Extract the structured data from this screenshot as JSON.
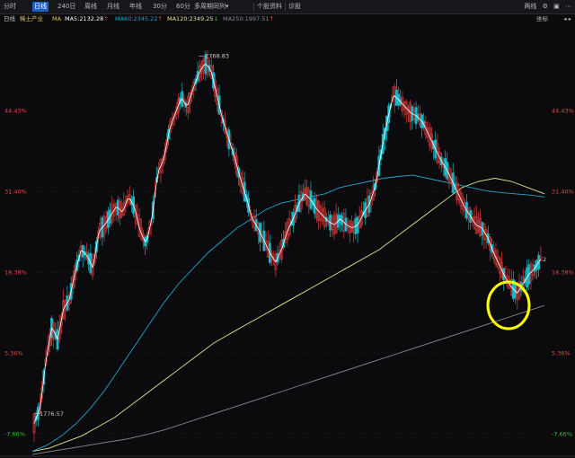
{
  "toolbar": {
    "tabs": [
      {
        "label": "分时",
        "active": false
      },
      {
        "label": "日线",
        "active": true
      },
      {
        "label": "240日",
        "active": false
      },
      {
        "label": "周线",
        "active": false
      },
      {
        "label": "月线",
        "active": false
      },
      {
        "label": "年线",
        "active": false
      },
      {
        "label": "30分",
        "active": false
      },
      {
        "label": "60分",
        "active": false
      }
    ],
    "multi_period": "多周期同列",
    "multi_period_arrow": "▾",
    "stock_info": "个股资料",
    "stock_review": "诊股",
    "right_label": "两线",
    "icons": [
      "settings-icon",
      "window-icon",
      "more-icon"
    ]
  },
  "infobar": {
    "period": "日线",
    "name": "稀土产业",
    "ma": "MA",
    "ma5": "MA5:2132.28",
    "ma5_arrow": "↑",
    "ma60": "MA60:2345.22",
    "ma60_arrow": "↑",
    "ma120": "MA120:2349.25",
    "ma120_arrow": "↓",
    "ma250": "MA250:1997.51",
    "ma250_arrow": "↑",
    "right_menu": "坐标",
    "right_ctrl": "◂ ▸"
  },
  "colors": {
    "up": "#e23b3b",
    "down": "#17b8c8",
    "ma5": "#ffffff",
    "ma60": "#1fa5c8",
    "ma120": "#e8e48a",
    "ma250": "#8a8a95",
    "axis_pos": "#e64545",
    "axis_neg": "#28c728",
    "grid": "#2a2a30",
    "highlight": "#ffff00"
  },
  "chart_data": {
    "type": "candlestick",
    "title": "稀土产业",
    "y_tick_labels": [
      "44.43%",
      "31.40%",
      "18.38%",
      "5.36%",
      "-7.66%"
    ],
    "y_tick_values": [
      44.43,
      31.4,
      18.38,
      5.36,
      -7.66
    ],
    "ylim": [
      -7.66,
      44.43
    ],
    "annotations": [
      {
        "label": "2768.83",
        "kind": "high"
      },
      {
        "label": "1776.57",
        "kind": "low"
      },
      {
        "label": "2",
        "kind": "last"
      }
    ],
    "close_series": [
      -6.0,
      -3.5,
      4.0,
      9.5,
      7.5,
      12.5,
      14.0,
      18.5,
      22.0,
      21.0,
      19.0,
      25.0,
      26.0,
      27.5,
      29.0,
      28.0,
      30.5,
      29.0,
      25.0,
      23.0,
      27.0,
      34.5,
      36.5,
      41.5,
      44.0,
      46.5,
      45.0,
      48.0,
      50.5,
      52.0,
      51.0,
      47.0,
      43.0,
      40.0,
      37.0,
      33.5,
      30.5,
      27.0,
      25.5,
      23.5,
      21.5,
      20.0,
      22.0,
      25.0,
      27.0,
      29.5,
      31.0,
      30.0,
      28.5,
      27.5,
      26.5,
      26.0,
      27.0,
      26.0,
      25.5,
      26.0,
      28.0,
      29.5,
      32.5,
      38.0,
      43.0,
      47.0,
      46.0,
      45.0,
      44.0,
      43.5,
      42.5,
      40.5,
      38.5,
      36.5,
      35.0,
      33.0,
      31.0,
      29.0,
      27.5,
      26.0,
      25.5,
      24.0,
      21.5,
      19.5,
      17.5,
      16.0,
      15.0,
      16.5,
      18.0,
      19.0,
      20.5
    ],
    "ma60": [
      -10.5,
      -9.5,
      -8.0,
      -6.0,
      -3.5,
      -0.5,
      3.0,
      6.5,
      10.0,
      13.5,
      16.5,
      19.0,
      21.5,
      23.5,
      25.5,
      27.0,
      28.5,
      29.5,
      30.0,
      30.5,
      31.0,
      32.0,
      32.5,
      33.0,
      33.5,
      33.8,
      34.0,
      33.5,
      33.0,
      32.5,
      32.0,
      31.5,
      31.2,
      31.0,
      30.8,
      30.5
    ],
    "ma120": [
      -10.5,
      -10.0,
      -9.0,
      -8.0,
      -6.5,
      -5.0,
      -3.0,
      -1.0,
      1.0,
      3.0,
      5.0,
      7.0,
      8.5,
      10.0,
      11.5,
      13.0,
      14.5,
      16.0,
      17.5,
      19.0,
      20.5,
      22.0,
      24.0,
      26.0,
      28.0,
      30.0,
      32.0,
      33.0,
      33.5,
      33.0,
      32.0,
      31.0
    ],
    "ma250": [
      -11.0,
      -10.5,
      -10.0,
      -9.5,
      -9.0,
      -8.5,
      -7.8,
      -7.0,
      -6.0,
      -5.0,
      -4.0,
      -3.0,
      -2.0,
      -1.0,
      0.0,
      1.0,
      2.0,
      3.0,
      4.0,
      5.0,
      6.0,
      7.0,
      8.0,
      9.0,
      10.0,
      11.0,
      12.0,
      13.0
    ]
  }
}
